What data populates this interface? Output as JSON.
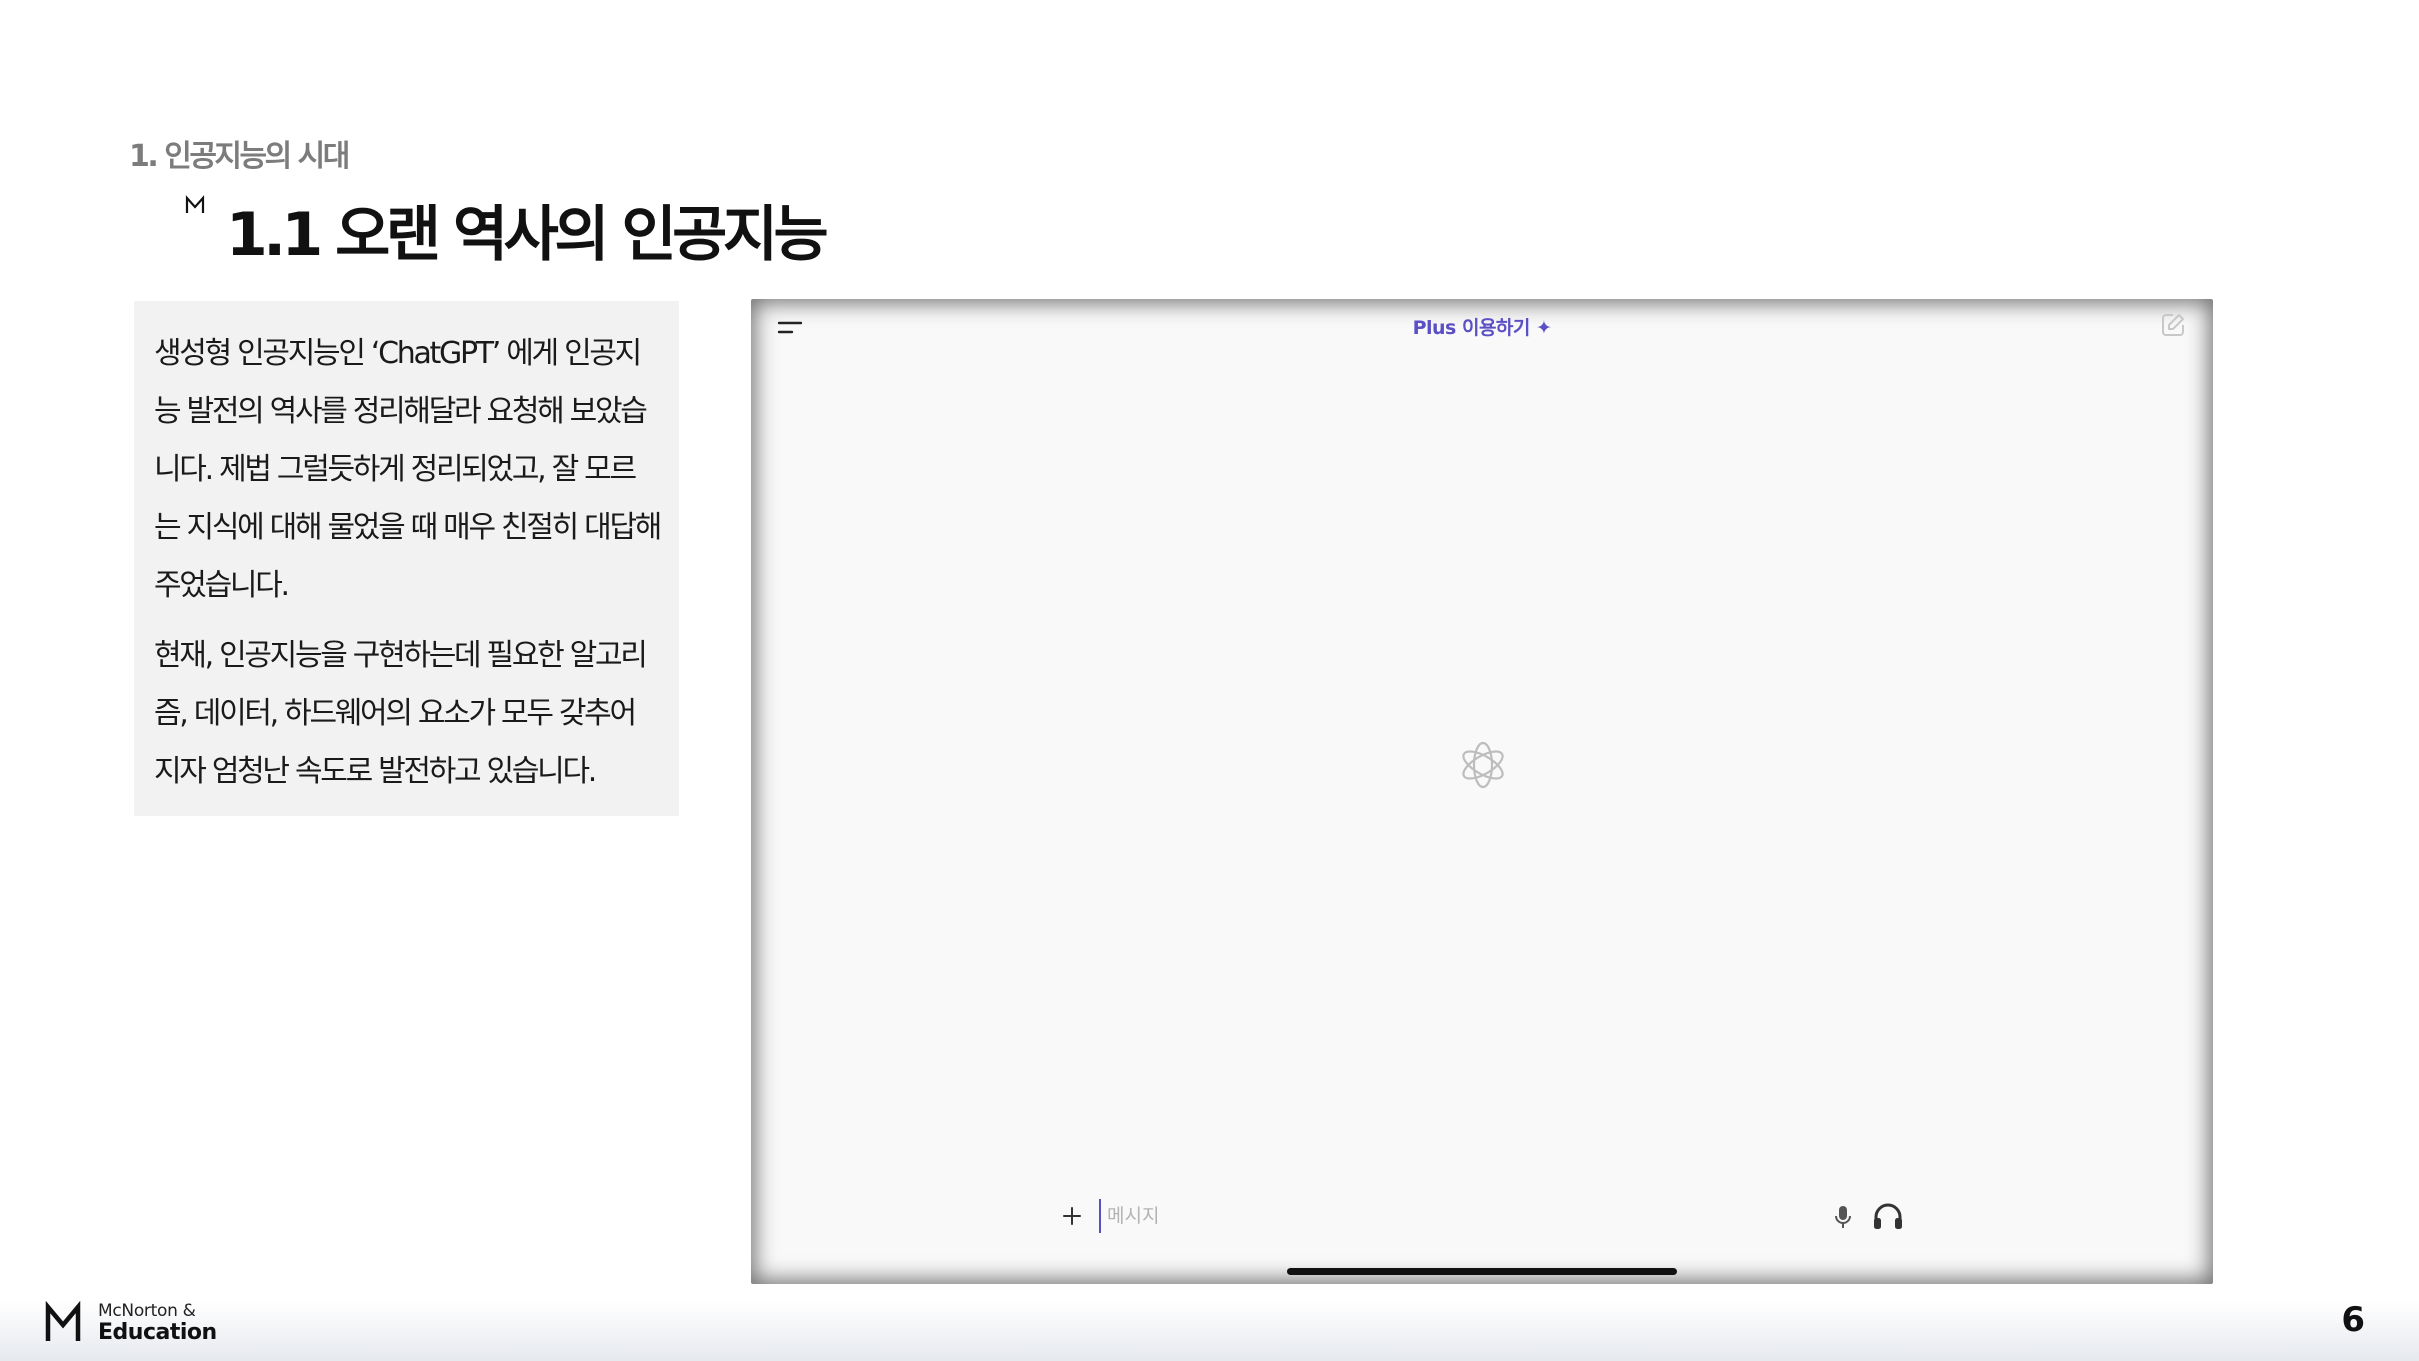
{
  "slide": {
    "section_label": "1. 인공지능의 시대",
    "title": "1.1 오랜 역사의 인공지능",
    "paragraphs": [
      "생성형 인공지능인 ‘ChatGPT’ 에게 인공지\n능 발전의 역사를 정리해달라 요청해 보았습\n니다. 제법 그럴듯하게  정리되었고, 잘 모르\n는 지식에 대해 물었을 때 매우 친절히 대답해\n주었습니다.",
      "현재, 인공지능을 구현하는데 필요한 알고리\n즘, 데이터, 하드웨어의 요소가 모두 갖추어\n지자 엄청난 속도로 발전하고 있습니다."
    ],
    "page_number": "6"
  },
  "app": {
    "upgrade_link": "Plus 이용하기 ✦",
    "composer_placeholder": "메시지",
    "icons": [
      "menu-icon",
      "edit-icon",
      "openai-logo-icon",
      "plus-icon",
      "mic-icon",
      "headphones-icon"
    ],
    "accent_color": "#5b4fc4"
  },
  "footer": {
    "brand_line1": "McNorton &",
    "brand_line2": "Education"
  }
}
